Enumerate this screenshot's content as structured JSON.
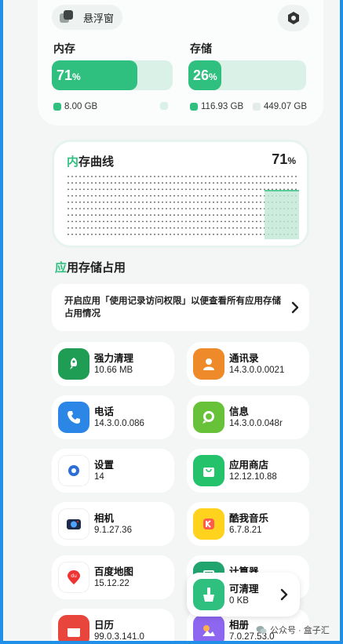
{
  "header": {
    "floating_window_label": "悬浮窗"
  },
  "memory": {
    "label": "内存",
    "percent": "71",
    "percent_unit": "%",
    "fill_fraction": 0.71,
    "used": "8.00 GB",
    "free": ""
  },
  "storage": {
    "label": "存储",
    "percent": "26",
    "percent_unit": "%",
    "fill_fraction": 0.26,
    "used": "116.93 GB",
    "free": "449.07 GB"
  },
  "curve": {
    "title_accent": "内",
    "title_rest": "存曲线",
    "value": "71",
    "value_unit": "%"
  },
  "app_storage": {
    "title_accent": "应",
    "title_rest": "用存储占用",
    "notice": "开启应用「使用记录访问权限」以便查看所有应用存储占用情况"
  },
  "apps": [
    {
      "name": "强力清理",
      "value": "10.66 MB",
      "icon": "rocket-icon",
      "color": "#1f9d55"
    },
    {
      "name": "通讯录",
      "value": "14.3.0.0.0021",
      "icon": "contacts-icon",
      "color": "#ef8a2b"
    },
    {
      "name": "电话",
      "value": "14.3.0.0.086",
      "icon": "phone-icon",
      "color": "#2b86e6"
    },
    {
      "name": "信息",
      "value": "14.3.0.0.048r",
      "icon": "message-icon",
      "color": "#67c23a"
    },
    {
      "name": "设置",
      "value": "14",
      "icon": "gear-icon",
      "color": "#ffffff"
    },
    {
      "name": "应用商店",
      "value": "12.12.10.88",
      "icon": "store-bag-icon",
      "color": "#24c36b"
    },
    {
      "name": "相机",
      "value": "9.1.27.36",
      "icon": "camera-icon",
      "color": "#ffffff"
    },
    {
      "name": "酷我音乐",
      "value": "6.7.8.21",
      "icon": "kuwo-music-icon",
      "color": "#ffd21e"
    },
    {
      "name": "百度地图",
      "value": "15.12.22",
      "icon": "baidu-map-icon",
      "color": "#ffffff"
    },
    {
      "name": "计算器",
      "value": "",
      "icon": "calculator-icon",
      "color": "#20a56f"
    },
    {
      "name": "日历",
      "value": "99.0.3.141.0",
      "icon": "calendar-icon",
      "color": "#e8453c"
    },
    {
      "name": "相册",
      "value": "7.0.27.53.0",
      "icon": "gallery-icon",
      "color": "#8e67f0"
    }
  ],
  "cleanable": {
    "label": "可清理",
    "value": "0 KB"
  },
  "watermark": {
    "text": "公众号 · 盒子汇"
  },
  "colors": {
    "accent": "#2fbf7f",
    "accent_light": "#d9f1e6",
    "background": "#f3f6f5"
  }
}
